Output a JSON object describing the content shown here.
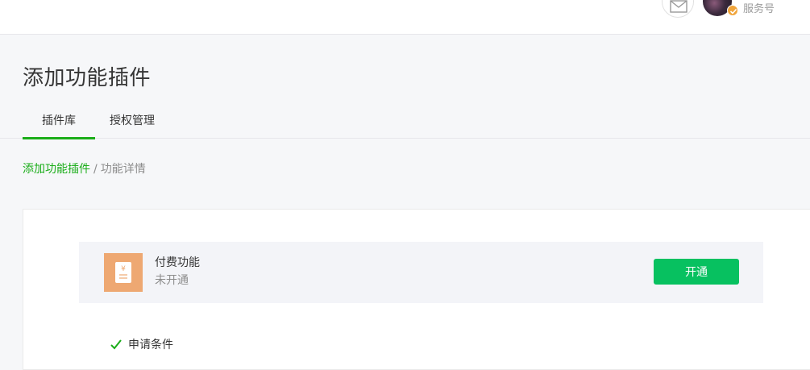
{
  "header": {
    "account_type": "服务号",
    "mail_icon": "mail-icon",
    "avatar_icon": "avatar",
    "badge_icon": "verified-check-icon",
    "badge_color": "#f0a43a"
  },
  "page": {
    "title": "添加功能插件"
  },
  "tabs": [
    {
      "label": "插件库",
      "active": true
    },
    {
      "label": "授权管理",
      "active": false
    }
  ],
  "breadcrumb": {
    "parent": "添加功能插件",
    "separator": "/",
    "current": "功能详情"
  },
  "feature": {
    "icon": "yuan-receipt-icon",
    "icon_bg": "#eea872",
    "name": "付费功能",
    "status": "未开通",
    "action_label": "开通",
    "action_color": "#07c160"
  },
  "section": {
    "heading": "申请条件",
    "icon": "check-arrow-icon"
  },
  "colors": {
    "accent": "#1aad19",
    "page_bg": "#f6f7f9"
  }
}
